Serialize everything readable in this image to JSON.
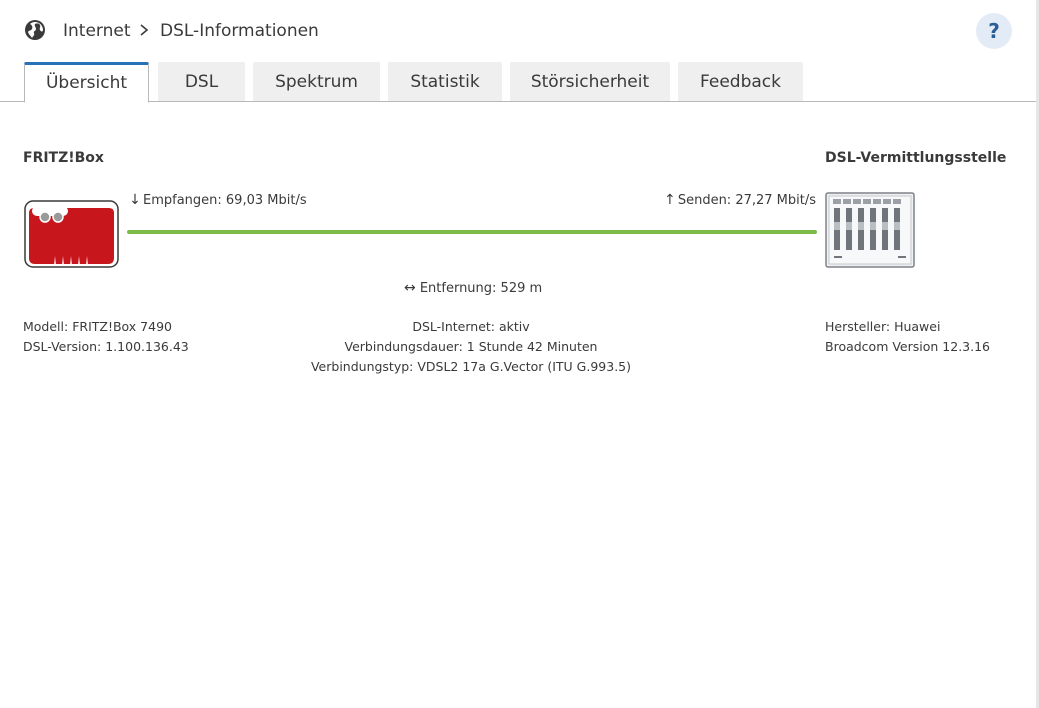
{
  "header": {
    "breadcrumb": [
      "Internet",
      "DSL-Informationen"
    ],
    "help_label": "?"
  },
  "tabs": [
    {
      "label": "Übersicht",
      "active": true
    },
    {
      "label": "DSL",
      "active": false
    },
    {
      "label": "Spektrum",
      "active": false
    },
    {
      "label": "Statistik",
      "active": false
    },
    {
      "label": "Störsicherheit",
      "active": false
    },
    {
      "label": "Feedback",
      "active": false
    }
  ],
  "overview": {
    "left_title": "FRITZ!Box",
    "right_title": "DSL-Vermittlungsstelle",
    "downstream": "Empfangen: 69,03 Mbit/s",
    "upstream": "Senden: 27,27 Mbit/s",
    "distance": "Entfernung: 529 m",
    "left_info": [
      "Modell: FRITZ!Box 7490",
      "DSL-Version: 1.100.136.43"
    ],
    "center_info": [
      "DSL-Internet: aktiv",
      "Verbindungsdauer: 1 Stunde 42 Minuten",
      "Verbindungstyp: VDSL2 17a G.Vector (ITU G.993.5)"
    ],
    "right_info": [
      "Hersteller: Huawei",
      "Broadcom Version 12.3.16"
    ]
  },
  "colors": {
    "accent": "#2a72b8",
    "line": "#7cbb48",
    "fritz_red": "#c8161d"
  },
  "icons": {
    "globe": "globe-icon",
    "chevron": "chevron-right-icon",
    "down": "arrow-down-icon",
    "up": "arrow-up-icon",
    "distance": "arrow-left-right-icon"
  }
}
